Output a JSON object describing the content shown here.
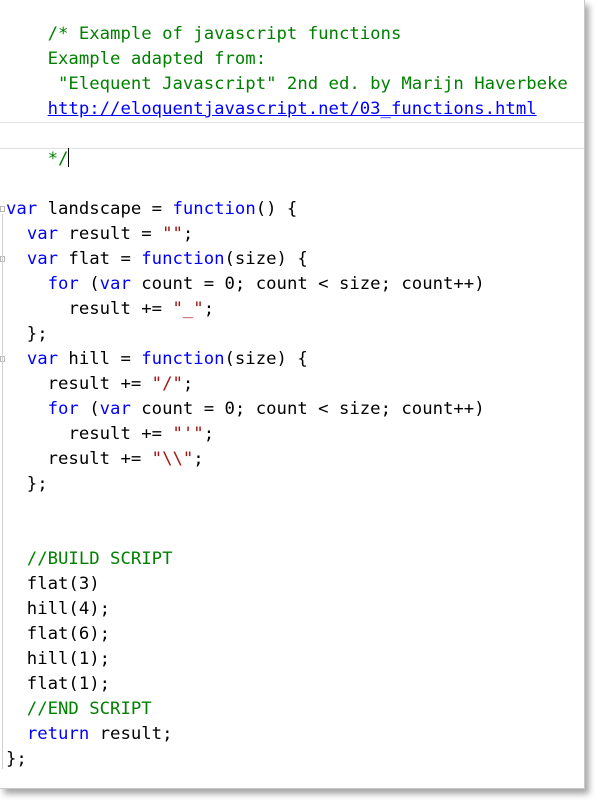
{
  "code": {
    "header_comment": {
      "line1": "/* Example of javascript functions",
      "line2": "Example adapted from:",
      "line3": " \"Elequent Javascript\" 2nd ed. by Marijn Haverbeke",
      "link": "http://eloquentjavascript.net/03_functions.html",
      "close": "*/"
    },
    "keywords": {
      "var": "var",
      "function": "function",
      "for": "for",
      "return": "return"
    },
    "landscape_decl": {
      "indent": "",
      "name": " landscape = ",
      "params": "() {"
    },
    "result_decl": {
      "indent": "  ",
      "name": " result = ",
      "value": "\"\"",
      "end": ";"
    },
    "flat_decl": {
      "indent": "  ",
      "name": " flat = ",
      "params": "(size) {"
    },
    "flat_for": {
      "indent": "    ",
      "open": " (",
      "body": " count = 0; count < size; count++)"
    },
    "flat_body": {
      "indent": "      ",
      "text": "result += ",
      "value": "\"_\"",
      "end": ";"
    },
    "close_brace_semi": "  };",
    "hill_decl": {
      "indent": "  ",
      "name": " hill = ",
      "params": "(size) {"
    },
    "hill_line1": {
      "indent": "    ",
      "text": "result += ",
      "value": "\"/\"",
      "end": ";"
    },
    "hill_for": {
      "indent": "    ",
      "open": " (",
      "body": " count = 0; count < size; count++)"
    },
    "hill_body": {
      "indent": "      ",
      "text": "result += ",
      "value": "\"'\"",
      "end": ";"
    },
    "hill_line3": {
      "indent": "    ",
      "text": "result += ",
      "value": "\"\\\\\"",
      "end": ";"
    },
    "build_comment": "  //BUILD SCRIPT",
    "calls": [
      "  flat(3)",
      "  hill(4);",
      "  flat(6);",
      "  hill(1);",
      "  flat(1);"
    ],
    "end_comment": "  //END SCRIPT",
    "return_line": {
      "indent": "  ",
      "rest": " result;"
    },
    "final_close": "};"
  },
  "colors": {
    "comment": "#008000",
    "keyword": "#0000ff",
    "string": "#a31515",
    "text": "#000000"
  }
}
